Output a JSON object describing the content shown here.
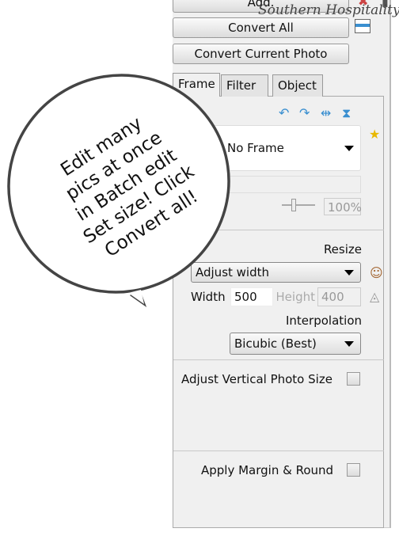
{
  "toolbar": {
    "add_label": "Add.",
    "convert_all_label": "Convert All",
    "convert_current_label": "Convert Current Photo"
  },
  "watermark": "Southern Hospitality",
  "tabs": [
    {
      "label": "Frame"
    },
    {
      "label": "Filter"
    },
    {
      "label": "Object"
    }
  ],
  "frame": {
    "selected": "No Frame",
    "opacity": "100%"
  },
  "resize": {
    "title": "Resize",
    "mode": "Adjust width",
    "width_label": "Width",
    "width_value": "500",
    "height_label": "Height",
    "height_value": "400",
    "interpolation_label": "Interpolation",
    "interpolation_value": "Bicubic (Best)"
  },
  "options": {
    "adjust_vertical_label": "Adjust Vertical Photo Size",
    "adjust_vertical_checked": false,
    "margin_round_label": "Apply Margin & Round",
    "margin_round_checked": false
  },
  "bubble": {
    "lines": [
      "Edit many",
      "pics at once",
      "in Batch edit",
      "Set size! Click",
      "Convert all!"
    ]
  },
  "colors": {
    "panel": "#f0f0f0",
    "icon_blue": "#3a8fd0"
  }
}
